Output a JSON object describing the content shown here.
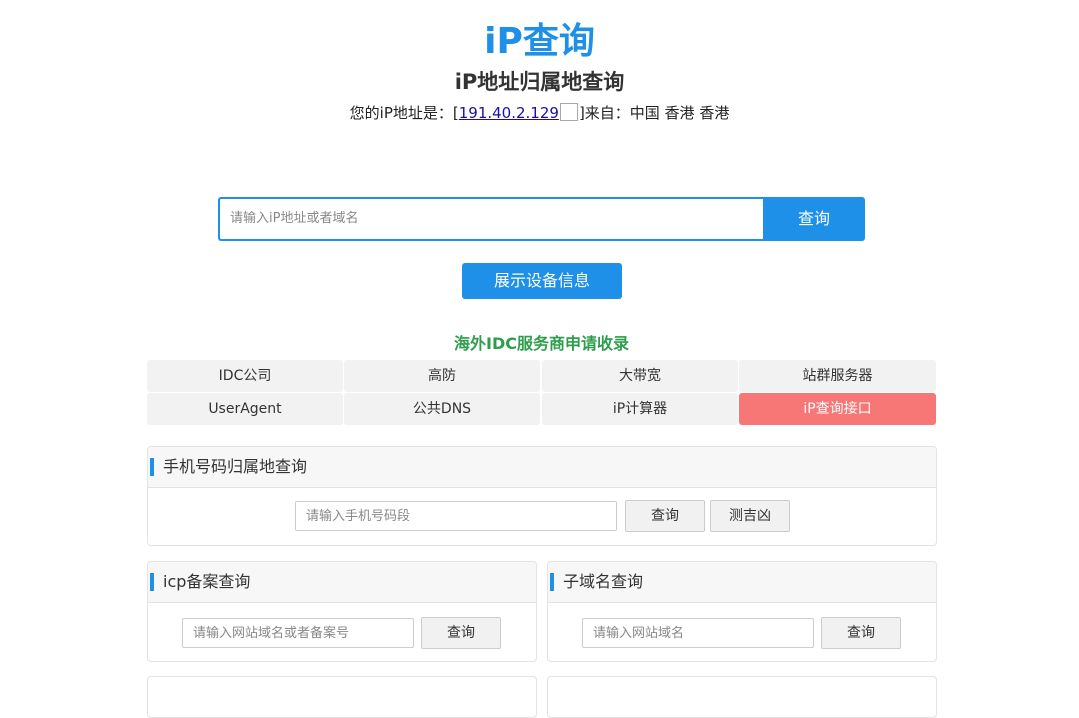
{
  "header": {
    "logo": "iP查询",
    "title": "iP地址归属地查询",
    "ip_prefix": "您的iP地址是：[",
    "ip_address": "191.40.2.129",
    "ip_suffix": "]来自：中国 香港 香港"
  },
  "search": {
    "placeholder": "请输入iP地址或者域名",
    "button_label": "查询"
  },
  "device_button_label": "展示设备信息",
  "idc": {
    "title": "海外IDC服务商申请收录",
    "links": [
      {
        "label": "IDC公司"
      },
      {
        "label": "高防"
      },
      {
        "label": "大带宽"
      },
      {
        "label": "站群服务器"
      },
      {
        "label": "UserAgent"
      },
      {
        "label": "公共DNS"
      },
      {
        "label": "iP计算器"
      },
      {
        "label": "iP查询接口"
      }
    ],
    "active_color": "#f77676"
  },
  "phone_panel": {
    "title": "手机号码归属地查询",
    "placeholder": "请输入手机号码段",
    "query_label": "查询",
    "luck_label": "测吉凶"
  },
  "icp_panel": {
    "title": "icp备案查询",
    "placeholder": "请输入网站域名或者备案号",
    "query_label": "查询"
  },
  "subdomain_panel": {
    "title": "子域名查询",
    "placeholder": "请输入网站域名",
    "query_label": "查询"
  },
  "colors": {
    "accent": "#1e90e8",
    "green": "#2e9e4e"
  }
}
